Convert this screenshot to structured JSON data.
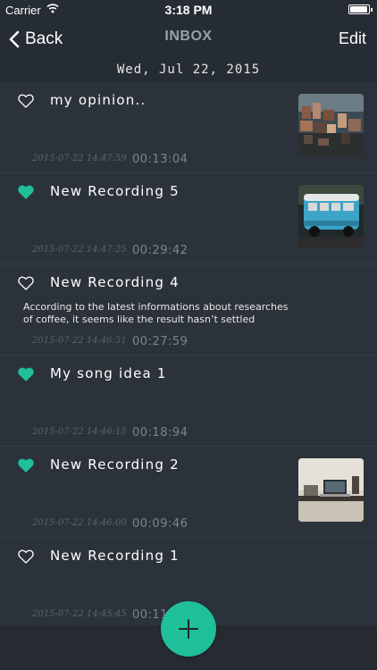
{
  "status_bar": {
    "carrier": "Carrier",
    "time": "3:18 PM",
    "battery_level": 0.95
  },
  "nav": {
    "back_label": "Back",
    "title": "INBOX",
    "edit_label": "Edit"
  },
  "date_header": "Wed, Jul 22, 2015",
  "colors": {
    "accent": "#1fbf99",
    "background": "#2b323a",
    "header": "#262c33"
  },
  "recordings": [
    {
      "title": "my opinion..",
      "favorite": false,
      "timestamp": "2015-07-22 14:47:59",
      "duration": "00:13:04",
      "description": "",
      "thumbnail": "city-hillside-photo"
    },
    {
      "title": "New Recording 5",
      "favorite": true,
      "timestamp": "2015-07-22 14:47:25",
      "duration": "00:29:42",
      "description": "",
      "thumbnail": "blue-van-photo"
    },
    {
      "title": "New Recording 4",
      "favorite": false,
      "timestamp": "2015-07-22 14:46:51",
      "duration": "00:27:59",
      "description": "According to the latest informations about researches of coffee, it seems like the result hasn’t settled",
      "thumbnail": ""
    },
    {
      "title": "My song idea 1",
      "favorite": true,
      "timestamp": "2015-07-22 14:46:15",
      "duration": "00:18:94",
      "description": "",
      "thumbnail": ""
    },
    {
      "title": "New Recording 2",
      "favorite": true,
      "timestamp": "2015-07-22 14:46:00",
      "duration": "00:09:46",
      "description": "",
      "thumbnail": "laptop-desk-photo"
    },
    {
      "title": "New Recording 1",
      "favorite": false,
      "timestamp": "2015-07-22 14:45:45",
      "duration": "00:11",
      "description": "",
      "thumbnail": ""
    }
  ],
  "fab_icon": "plus-icon"
}
